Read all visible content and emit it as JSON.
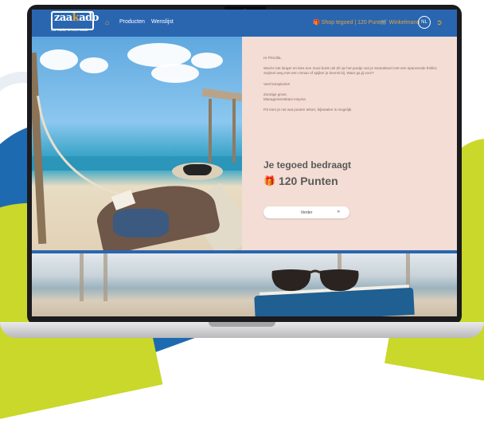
{
  "nav": {
    "logo_text_pre": "zaa",
    "logo_text_k": "k",
    "logo_text_post": "ado",
    "logo_tagline": "Uw Kado, is onze Zaak",
    "home_icon": "home-icon",
    "products_label": "Producten",
    "wishlist_label": "Wenslijst",
    "credit_label": "Shop tegoed | 120 Punten",
    "cart_label": "Winkelmand",
    "language_label": "NL"
  },
  "message": {
    "greeting": "Hi Priscilla,",
    "paragraph1": "Wacht niet langer en kies een mooi boek uit! Zit op het puntje van je strandstoel met een spannende thriller, zwijmel weg met een roman of spijker je kennis bij. Waar ga jij voor?",
    "paragraph2": "Veel leesplezier!",
    "signoff_line1": "Zonnige groet,",
    "signoff_line2": "Managementteam Heyma",
    "postscript": "PS kom je net wat punten tekort, bijbetalen is mogelijk."
  },
  "credit": {
    "title": "Je tegoed bedraagt",
    "amount": "120 Punten"
  },
  "cta": {
    "next_label": "Verder",
    "next_arrow": "»"
  },
  "colors": {
    "brand_blue": "#2a66b0",
    "accent_orange": "#e6a13a",
    "panel_bg": "#f3ddd5",
    "lime": "#c9d82a"
  }
}
